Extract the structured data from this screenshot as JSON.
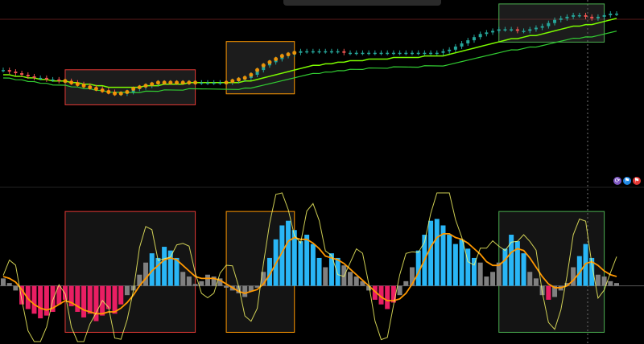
{
  "colors": {
    "bg": "#000000",
    "up": "#26a69a",
    "down": "#ef5350",
    "box_red": "#e53935",
    "box_orange": "#ff9800",
    "box_green": "#4caf50",
    "ema_fast": "#7cfc00",
    "ema_slow": "#32cd32",
    "osc_blue": "#29b6f6",
    "osc_pink": "#e91e63",
    "osc_gray": "#808080",
    "osc_orange": "#ff9800",
    "osc_yellow": "#ffff66"
  },
  "toolbar_icons": [
    "refresh-icon",
    "flag-icon",
    "flag-icon-2"
  ],
  "chart_data": [
    {
      "type": "line",
      "name": "price",
      "title": "",
      "xlabel": "",
      "ylabel": "",
      "x_range": [
        0,
        100
      ],
      "y_range": [
        0,
        100
      ],
      "close": [
        63,
        62,
        61,
        60,
        59,
        58,
        58,
        57,
        57,
        56,
        56,
        55,
        54,
        53,
        52,
        51,
        50,
        49,
        48,
        48,
        49,
        51,
        52,
        53,
        54,
        55,
        55,
        55,
        55,
        55,
        55,
        55,
        55,
        55,
        55,
        55,
        55,
        56,
        57,
        58,
        60,
        63,
        66,
        68,
        70,
        72,
        73,
        74,
        75,
        75,
        75,
        75,
        75,
        75,
        75,
        74,
        74,
        74,
        74,
        74,
        74,
        74,
        74,
        74,
        74,
        74,
        74,
        74,
        74,
        74,
        74,
        75,
        76,
        78,
        80,
        82,
        84,
        86,
        87,
        88,
        89,
        89,
        89,
        88,
        88,
        89,
        90,
        91,
        93,
        95,
        96,
        97,
        98,
        98,
        97,
        96,
        97,
        98,
        99,
        99
      ],
      "ema": [
        60,
        60,
        59,
        59,
        58,
        58,
        57,
        57,
        56,
        56,
        56,
        55,
        55,
        54,
        54,
        53,
        53,
        52,
        52,
        52,
        52,
        52,
        52,
        53,
        53,
        53,
        54,
        54,
        54,
        54,
        55,
        55,
        55,
        55,
        55,
        55,
        55,
        55,
        55,
        56,
        56,
        57,
        58,
        59,
        60,
        61,
        62,
        63,
        64,
        65,
        66,
        66,
        67,
        67,
        68,
        68,
        69,
        69,
        69,
        70,
        70,
        70,
        70,
        71,
        71,
        71,
        71,
        71,
        72,
        72,
        72,
        72,
        73,
        74,
        75,
        76,
        77,
        78,
        79,
        80,
        81,
        82,
        83,
        83,
        84,
        85,
        85,
        86,
        87,
        88,
        89,
        90,
        91,
        91,
        92,
        92,
        93,
        94,
        95,
        96
      ],
      "zones": [
        {
          "kind": "red",
          "from": 10,
          "to": 31
        },
        {
          "kind": "orange",
          "from": 36,
          "to": 47
        },
        {
          "kind": "green",
          "from": 80,
          "to": 97
        }
      ]
    },
    {
      "type": "bar",
      "name": "oscillator",
      "title": "",
      "xlabel": "",
      "ylabel": "",
      "y_range": [
        -60,
        100
      ],
      "values": [
        8,
        3,
        -5,
        -20,
        -25,
        -30,
        -35,
        -32,
        -28,
        -20,
        -15,
        -22,
        -28,
        -34,
        -30,
        -38,
        -32,
        -25,
        -30,
        -20,
        -10,
        -5,
        12,
        25,
        35,
        30,
        42,
        38,
        30,
        15,
        10,
        2,
        5,
        12,
        10,
        8,
        -2,
        -5,
        -8,
        -12,
        -6,
        -2,
        15,
        30,
        50,
        65,
        70,
        60,
        48,
        55,
        45,
        30,
        20,
        35,
        30,
        22,
        15,
        10,
        5,
        -5,
        -15,
        -20,
        -25,
        -18,
        -10,
        5,
        20,
        38,
        55,
        70,
        72,
        65,
        55,
        45,
        50,
        40,
        30,
        25,
        10,
        15,
        25,
        40,
        55,
        48,
        35,
        15,
        8,
        -10,
        -15,
        -12,
        -5,
        3,
        20,
        32,
        45,
        30,
        12,
        10,
        5,
        3
      ],
      "signal": [
        10,
        8,
        4,
        -4,
        -14,
        -20,
        -24,
        -26,
        -24,
        -20,
        -16,
        -18,
        -22,
        -26,
        -28,
        -30,
        -30,
        -28,
        -28,
        -24,
        -18,
        -10,
        0,
        8,
        16,
        22,
        28,
        30,
        28,
        22,
        16,
        10,
        8,
        8,
        8,
        6,
        2,
        -2,
        -6,
        -8,
        -6,
        -4,
        2,
        12,
        24,
        36,
        48,
        52,
        50,
        50,
        46,
        40,
        32,
        30,
        28,
        24,
        18,
        12,
        6,
        0,
        -6,
        -12,
        -16,
        -16,
        -14,
        -8,
        2,
        14,
        28,
        42,
        52,
        56,
        56,
        52,
        50,
        46,
        40,
        34,
        26,
        22,
        22,
        28,
        36,
        40,
        38,
        30,
        20,
        10,
        2,
        -2,
        -2,
        0,
        6,
        14,
        24,
        26,
        22,
        16,
        12,
        10
      ]
    }
  ]
}
